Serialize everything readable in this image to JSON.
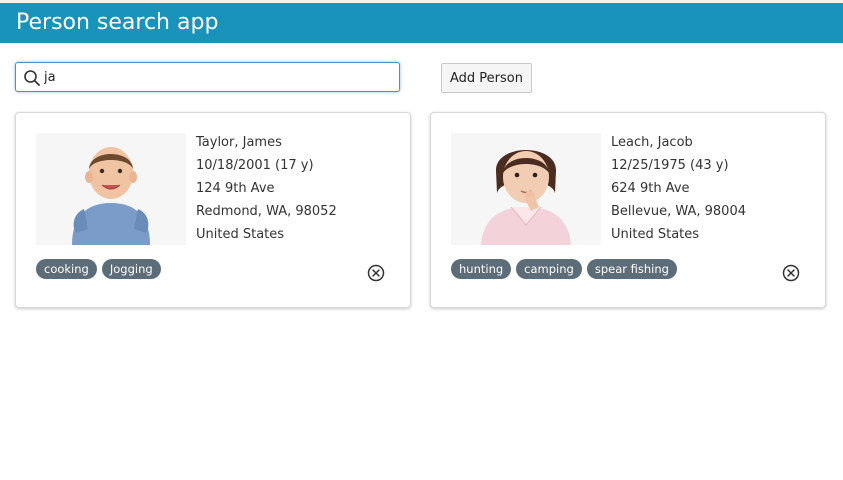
{
  "app": {
    "title": "Person search app"
  },
  "search": {
    "value": "ja",
    "icon": "search-icon"
  },
  "toolbar": {
    "add_label": "Add Person"
  },
  "colors": {
    "header": "#1a93bb",
    "tag": "#5c6c78"
  },
  "people": [
    {
      "name": "Taylor, James",
      "dob": "10/18/2001 (17 y)",
      "street": "124 9th Ave",
      "city": "Redmond, WA, 98052",
      "country": "United States",
      "tags": [
        "cooking",
        "Jogging"
      ]
    },
    {
      "name": "Leach, Jacob",
      "dob": "12/25/1975 (43 y)",
      "street": "624 9th Ave",
      "city": "Bellevue, WA, 98004",
      "country": "United States",
      "tags": [
        "hunting",
        "camping",
        "spear fishing"
      ]
    }
  ]
}
